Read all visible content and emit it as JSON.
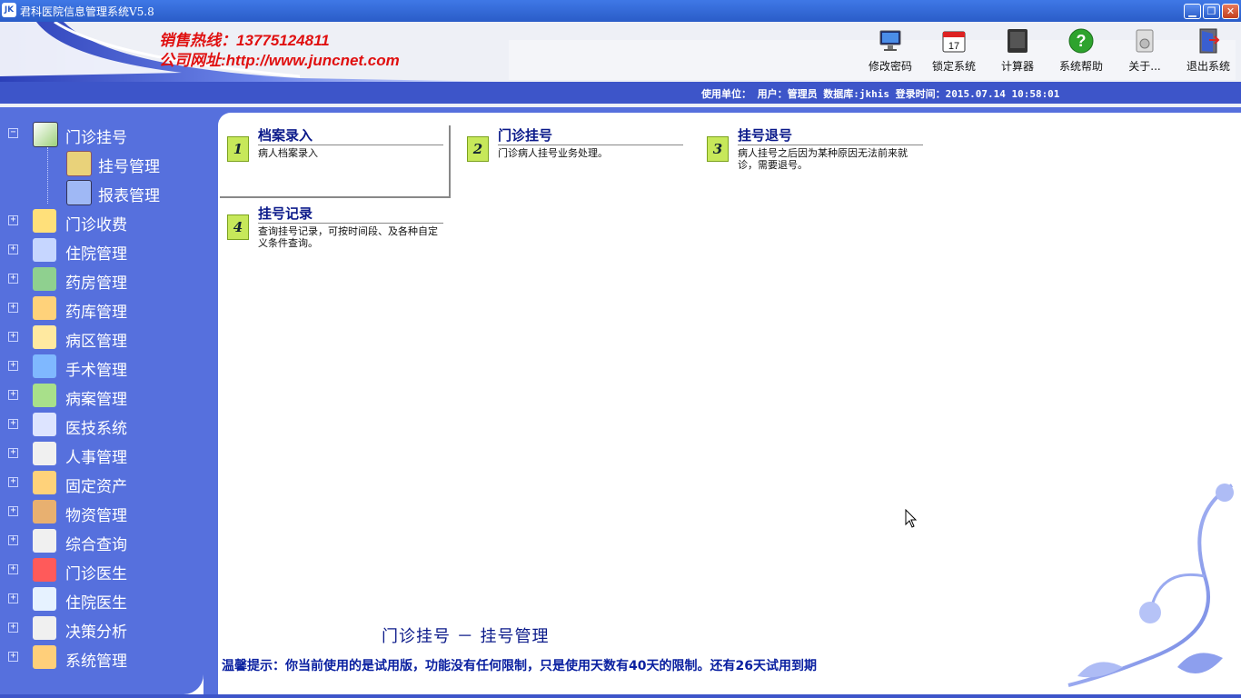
{
  "window": {
    "title": "君科医院信息管理系统V5.8",
    "app_icon_text": "JK",
    "buttons": {
      "minimize": "▁",
      "restore": "❐",
      "close": "✕"
    }
  },
  "header": {
    "hotline": "销售热线：13775124811",
    "website": "公司网址:http://www.juncnet.com",
    "toolbar": [
      {
        "label": "修改密码",
        "icon": "monitor-icon"
      },
      {
        "label": "锁定系统",
        "icon": "calendar-icon"
      },
      {
        "label": "计算器",
        "icon": "calculator-icon"
      },
      {
        "label": "系统帮助",
        "icon": "help-icon"
      },
      {
        "label": "关于...",
        "icon": "about-icon"
      },
      {
        "label": "退出系统",
        "icon": "exit-door-icon"
      }
    ],
    "calendar_day": "17",
    "info": "使用单位：  用户：管理员  数据库:jkhis 登录时间：2015.07.14 10:58:01"
  },
  "sidebar": {
    "expanded": {
      "label": "门诊挂号",
      "expander": "−",
      "children": [
        {
          "label": "挂号管理",
          "icon": "arrow-right-icon"
        },
        {
          "label": "报表管理",
          "icon": "report-icon"
        }
      ]
    },
    "items": [
      {
        "label": "门诊收费",
        "icon": "cashier-icon"
      },
      {
        "label": "住院管理",
        "icon": "hospital-icon"
      },
      {
        "label": "药房管理",
        "icon": "pharmacy-icon"
      },
      {
        "label": "药库管理",
        "icon": "warehouse-icon"
      },
      {
        "label": "病区管理",
        "icon": "ward-icon"
      },
      {
        "label": "手术管理",
        "icon": "surgery-icon"
      },
      {
        "label": "病案管理",
        "icon": "records-icon"
      },
      {
        "label": "医技系统",
        "icon": "medtech-icon"
      },
      {
        "label": "人事管理",
        "icon": "personnel-icon"
      },
      {
        "label": "固定资产",
        "icon": "assets-icon"
      },
      {
        "label": "物资管理",
        "icon": "materials-icon"
      },
      {
        "label": "综合查询",
        "icon": "query-icon"
      },
      {
        "label": "门诊医生",
        "icon": "doctor-icon"
      },
      {
        "label": "住院医生",
        "icon": "inpatient-doctor-icon"
      },
      {
        "label": "决策分析",
        "icon": "analysis-icon"
      },
      {
        "label": "系统管理",
        "icon": "system-icon"
      }
    ],
    "collapsed_expander": "+"
  },
  "main": {
    "cards": [
      {
        "num": "1",
        "title": "档案录入",
        "desc": "病人档案录入"
      },
      {
        "num": "2",
        "title": "门诊挂号",
        "desc": "门诊病人挂号业务处理。"
      },
      {
        "num": "3",
        "title": "挂号退号",
        "desc": "病人挂号之后因为某种原因无法前来就诊，需要退号。"
      },
      {
        "num": "4",
        "title": "挂号记录",
        "desc": "查询挂号记录，可按时间段、及各种自定义条件查询。"
      }
    ],
    "status_title": "门诊挂号 － 挂号管理",
    "notice": "温馨提示：你当前使用的是试用版，功能没有任何限制，只是使用天数有40天的限制。还有26天试用到期"
  },
  "colors": {
    "sidebar_bg": "#5670dd",
    "infobar_bg": "#3d55c9",
    "hotline": "#e01010",
    "card_title": "#0b1a8a"
  }
}
